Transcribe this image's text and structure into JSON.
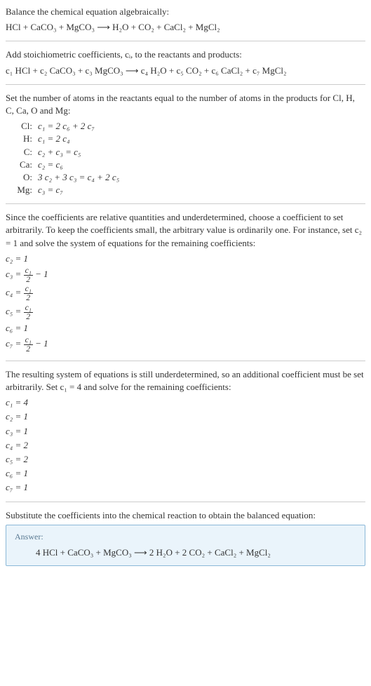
{
  "title": "Balance the chemical equation algebraically:",
  "main_equation": "HCl + CaCO₃ + MgCO₃  ⟶  H₂O + CO₂ + CaCl₂ + MgCl₂",
  "stoich_intro": "Add stoichiometric coefficients, cᵢ, to the reactants and products:",
  "stoich_equation": "c₁ HCl + c₂ CaCO₃ + c₃ MgCO₃  ⟶  c₄ H₂O + c₅ CO₂ + c₆ CaCl₂ + c₇ MgCl₂",
  "atoms_intro": "Set the number of atoms in the reactants equal to the number of atoms in the products for Cl, H, C, Ca, O and Mg:",
  "atoms": [
    {
      "el": "Cl:",
      "eq": "c₁ = 2 c₆ + 2 c₇"
    },
    {
      "el": "H:",
      "eq": "c₁ = 2 c₄"
    },
    {
      "el": "C:",
      "eq": "c₂ + c₃ = c₅"
    },
    {
      "el": "Ca:",
      "eq": "c₂ = c₆"
    },
    {
      "el": "O:",
      "eq": "3 c₂ + 3 c₃ = c₄ + 2 c₅"
    },
    {
      "el": "Mg:",
      "eq": "c₃ = c₇"
    }
  ],
  "underdet1": "Since the coefficients are relative quantities and underdetermined, choose a coefficient to set arbitrarily. To keep the coefficients small, the arbitrary value is ordinarily one. For instance, set c₂ = 1 and solve the system of equations for the remaining coefficients:",
  "coeffs1": {
    "c2": "c₂ = 1",
    "c3_pre": "c₃ = ",
    "c3_num": "c₁",
    "c3_den": "2",
    "c3_post": " − 1",
    "c4_pre": "c₄ = ",
    "c4_num": "c₁",
    "c4_den": "2",
    "c5_pre": "c₅ = ",
    "c5_num": "c₁",
    "c5_den": "2",
    "c6": "c₆ = 1",
    "c7_pre": "c₇ = ",
    "c7_num": "c₁",
    "c7_den": "2",
    "c7_post": " − 1"
  },
  "underdet2": "The resulting system of equations is still underdetermined, so an additional coefficient must be set arbitrarily. Set c₁ = 4 and solve for the remaining coefficients:",
  "coeffs2": [
    "c₁ = 4",
    "c₂ = 1",
    "c₃ = 1",
    "c₄ = 2",
    "c₅ = 2",
    "c₆ = 1",
    "c₇ = 1"
  ],
  "substitute": "Substitute the coefficients into the chemical reaction to obtain the balanced equation:",
  "answer_label": "Answer:",
  "answer_equation": "4 HCl + CaCO₃ + MgCO₃  ⟶  2 H₂O + 2 CO₂ + CaCl₂ + MgCl₂"
}
